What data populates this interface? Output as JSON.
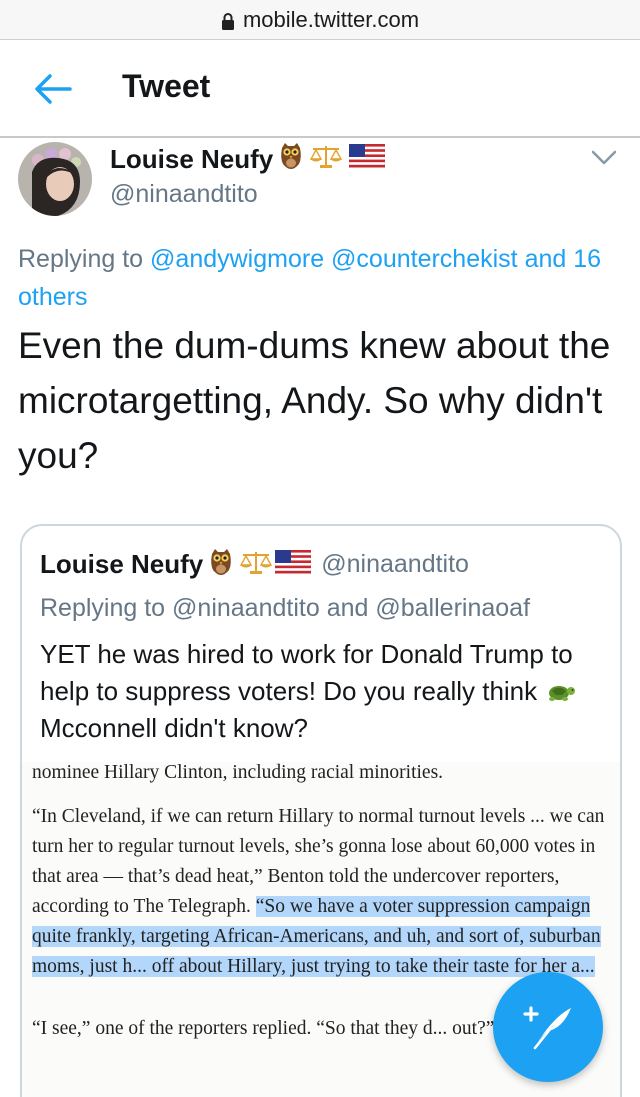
{
  "browser": {
    "url": "mobile.twitter.com"
  },
  "header": {
    "title": "Tweet"
  },
  "tweet": {
    "author_name": "Louise Neufy",
    "author_handle": "@ninaandtito",
    "replying_prefix": "Replying to",
    "replying_to_1": "@andywigmore",
    "replying_to_2": "@counterchekist",
    "replying_others": "and 16 others",
    "text": "Even the dum-dums knew about the microtargetting, Andy. So why didn't you?"
  },
  "quoted_tweet": {
    "author_name": "Louise Neufy",
    "author_handle": "@ninaandtito",
    "replying_prefix": "Replying to",
    "replying_to_1": "@ninaandtito",
    "replying_and": "and",
    "replying_to_2": "@ballerinaoaf",
    "text_part1": "YET he was hired to work for Donald Trump to help to suppress voters! Do you really think ",
    "text_part2": "Mcconnell didn't know?",
    "image_text": {
      "line0": "nominee Hillary Clinton, including racial minorities.",
      "para2_before": "“In Cleveland, if we can return Hillary to normal turnout levels ... we can turn her to regular turnout levels, she’s gonna lose about 60,000 votes in that area — that’s dead heat,” Benton told the undercover reporters, according to The Telegraph. ",
      "para2_highlight": "“So we have a voter suppression campaign quite frankly, targeting African-Americans, and uh, and sort of, suburban moms, just h... off about Hillary, just trying to take their taste for her a...",
      "para3": "“I see,” one of the reporters replied. “So that they d... out?”"
    }
  },
  "icons": {
    "lock": "lock-icon",
    "back": "arrow-left-icon",
    "caret": "chevron-down-icon",
    "compose": "compose-tweet-icon",
    "owl": "owl-emoji",
    "scales": "scales-emoji",
    "flag": "us-flag-emoji",
    "turtle": "turtle-emoji"
  },
  "colors": {
    "accent": "#1da1f2",
    "text": "#14171a",
    "secondary": "#657786",
    "highlight": "#b3d7fb"
  }
}
